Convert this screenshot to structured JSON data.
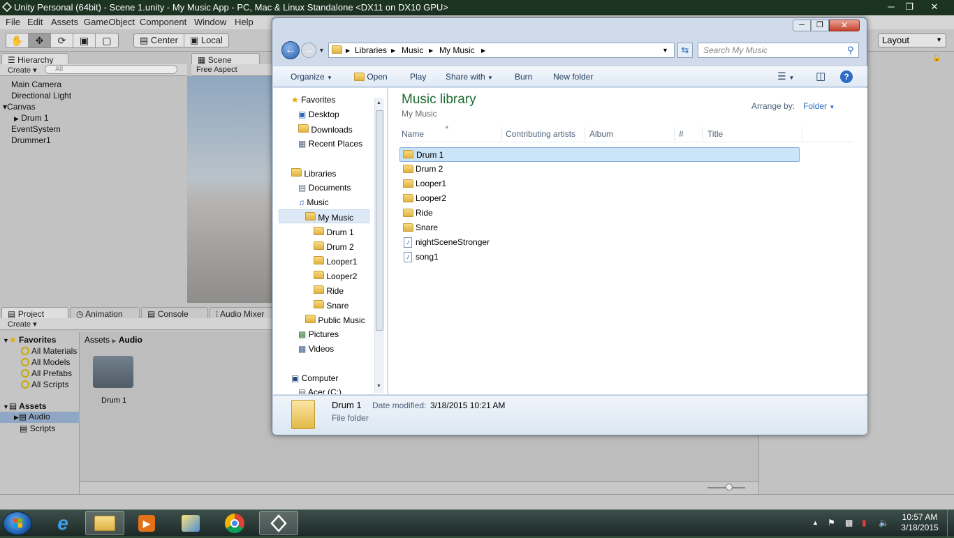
{
  "unity": {
    "title": "Unity Personal (64bit) - Scene 1.unity - My Music App - PC, Mac & Linux Standalone <DX11 on DX10 GPU>",
    "menu": [
      "File",
      "Edit",
      "Assets",
      "GameObject",
      "Component",
      "Window",
      "Help"
    ],
    "toolbar": {
      "center_label": "Center",
      "local_label": "Local",
      "layout_label": "Layout"
    },
    "hierarchy": {
      "tab": "Hierarchy",
      "create_label": "Create",
      "search_placeholder": "All",
      "items": [
        "Main Camera",
        "Directional Light",
        "Canvas",
        "Drum 1",
        "EventSystem",
        "Drummer1"
      ]
    },
    "scene": {
      "tab": "Scene",
      "aspect": "Free Aspect"
    },
    "bottom_tabs": [
      "Project",
      "Animation",
      "Console",
      "Audio Mixer"
    ],
    "project": {
      "create_label": "Create",
      "favorites_label": "Favorites",
      "favorites": [
        "All Materials",
        "All Models",
        "All Prefabs",
        "All Scripts"
      ],
      "assets_label": "Assets",
      "assets": [
        "Audio",
        "Scripts"
      ],
      "breadcrumb": [
        "Assets",
        "Audio"
      ],
      "grid_item": "Drum 1"
    }
  },
  "explorer": {
    "breadcrumb": [
      "Libraries",
      "Music",
      "My Music"
    ],
    "search_placeholder": "Search My Music",
    "commands": {
      "organize": "Organize",
      "open": "Open",
      "play": "Play",
      "share": "Share with",
      "burn": "Burn",
      "new_folder": "New folder"
    },
    "nav": {
      "favorites": "Favorites",
      "favorites_items": [
        "Desktop",
        "Downloads",
        "Recent Places"
      ],
      "libraries": "Libraries",
      "documents": "Documents",
      "music": "Music",
      "my_music": "My Music",
      "my_music_children": [
        "Drum 1",
        "Drum 2",
        "Looper1",
        "Looper2",
        "Ride",
        "Snare"
      ],
      "public_music": "Public Music",
      "pictures": "Pictures",
      "videos": "Videos",
      "computer": "Computer",
      "drive": "Acer (C:)"
    },
    "library_title": "Music library",
    "library_sub": "My Music",
    "arrange_label": "Arrange by:",
    "arrange_value": "Folder",
    "columns": [
      "Name",
      "Contributing artists",
      "Album",
      "#",
      "Title"
    ],
    "files": [
      {
        "name": "Drum 1",
        "type": "folder"
      },
      {
        "name": "Drum 2",
        "type": "folder"
      },
      {
        "name": "Looper1",
        "type": "folder"
      },
      {
        "name": "Looper2",
        "type": "folder"
      },
      {
        "name": "Ride",
        "type": "folder"
      },
      {
        "name": "Snare",
        "type": "folder"
      },
      {
        "name": "nightSceneStronger",
        "type": "music"
      },
      {
        "name": "song1",
        "type": "music"
      }
    ],
    "details": {
      "name": "Drum 1",
      "date_label": "Date modified:",
      "date_value": "3/18/2015 10:21 AM",
      "type": "File folder"
    }
  },
  "taskbar": {
    "time": "10:57 AM",
    "date": "3/18/2015"
  }
}
